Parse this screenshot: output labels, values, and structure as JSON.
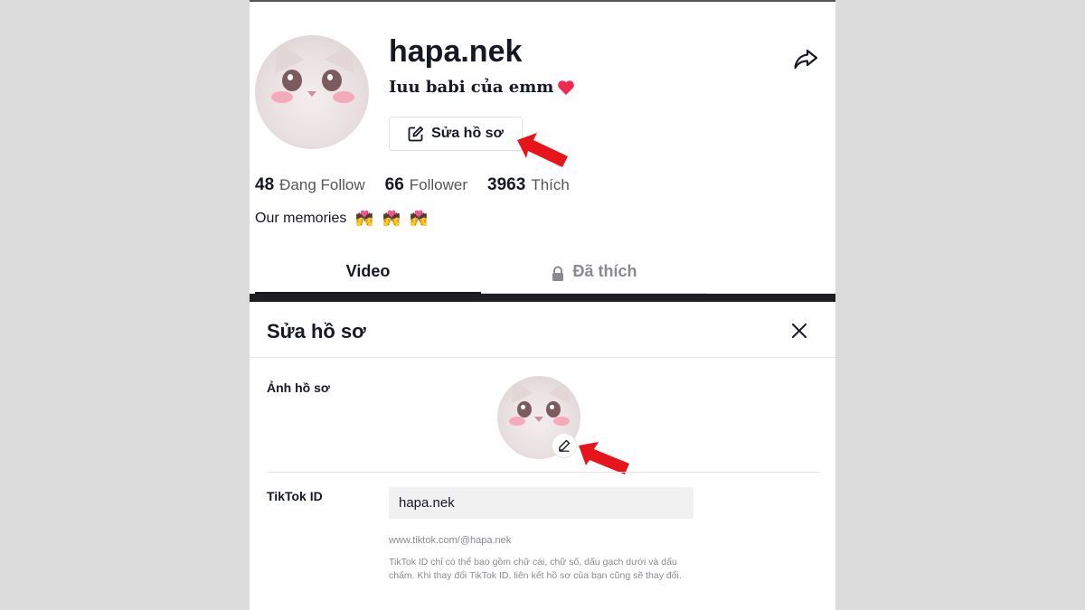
{
  "profile": {
    "username": "hapa.nek",
    "bio": "Iuu babi của emm",
    "edit_button_label": "Sửa hồ sơ",
    "stats": [
      {
        "count": "48",
        "label": "Đang Follow"
      },
      {
        "count": "66",
        "label": "Follower"
      },
      {
        "count": "3963",
        "label": "Thích"
      }
    ],
    "description": "Our memories",
    "tabs": {
      "video": "Video",
      "liked": "Đã thích"
    }
  },
  "edit_dialog": {
    "title": "Sửa hồ sơ",
    "photo_label": "Ảnh hồ sơ",
    "tiktok_id_label": "TikTok ID",
    "tiktok_id_value": "hapa.nek",
    "profile_url": "www.tiktok.com/@hapa.nek",
    "id_hint": "TikTok ID chỉ có thể bao gồm chữ cái, chữ số, dấu gạch dưới và dấu chấm. Khi thay đổi TikTok ID, liên kết hồ sơ của bạn cũng sẽ thay đổi."
  },
  "icons": {
    "heart": "heart-icon",
    "edit": "edit-icon",
    "share": "share-icon",
    "lock": "lock-icon",
    "close": "close-icon",
    "pencil": "pencil-icon",
    "kiss_emoji": "kiss-emoji-icon"
  },
  "colors": {
    "text": "#161823",
    "muted": "#8a8b91",
    "annotation_arrow": "#e8141c",
    "heart": "#ef2950",
    "background": "#dcdcdc"
  }
}
